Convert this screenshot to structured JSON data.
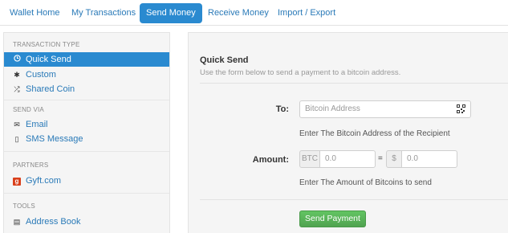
{
  "nav": {
    "tabs": [
      {
        "label": "Wallet Home"
      },
      {
        "label": "My Transactions"
      },
      {
        "label": "Send Money",
        "active": true
      },
      {
        "label": "Receive Money"
      },
      {
        "label": "Import / Export"
      }
    ]
  },
  "sidebar": {
    "sections": [
      {
        "header": "TRANSACTION TYPE",
        "items": [
          {
            "label": "Quick Send",
            "icon": "clock-icon",
            "active": true
          },
          {
            "label": "Custom",
            "icon": "gear-icon"
          },
          {
            "label": "Shared Coin",
            "icon": "shuffle-icon"
          }
        ]
      },
      {
        "header": "SEND VIA",
        "items": [
          {
            "label": "Email",
            "icon": "envelope-icon"
          },
          {
            "label": "SMS Message",
            "icon": "phone-icon"
          }
        ]
      },
      {
        "header": "PARTNERS",
        "items": [
          {
            "label": "Gyft.com",
            "icon": "gyft-logo-icon"
          }
        ]
      },
      {
        "header": "TOOLS",
        "items": [
          {
            "label": "Address Book",
            "icon": "book-icon"
          }
        ]
      }
    ]
  },
  "main": {
    "title": "Quick Send",
    "description": "Use the form below to send a payment to a bitcoin address.",
    "to_label": "To:",
    "address_placeholder": "Bitcoin Address",
    "address_help": "Enter The Bitcoin Address of the Recipient",
    "amount_label": "Amount:",
    "btc_unit": "BTC",
    "btc_placeholder": "0.0",
    "equals": "=",
    "usd_unit": "$",
    "usd_placeholder": "0.0",
    "amount_help": "Enter The Amount of Bitcoins to send",
    "send_button": "Send Payment"
  },
  "colors": {
    "accent": "#2a8ad0",
    "link": "#2a7ab8",
    "send_button": "#5bb75b",
    "gyft": "#d9401b"
  }
}
